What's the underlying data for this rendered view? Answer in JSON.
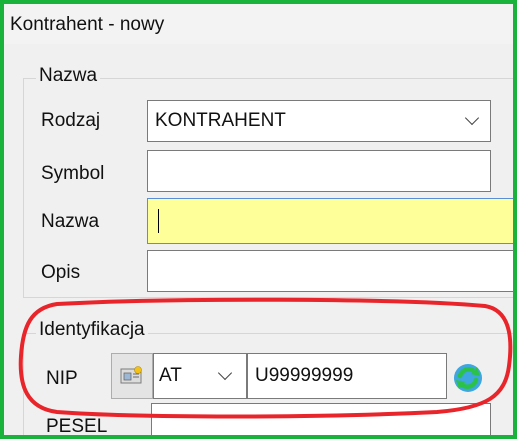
{
  "window": {
    "title": "Kontrahent - nowy",
    "border_color": "#19b23a"
  },
  "nazwa_group": {
    "legend": "Nazwa",
    "rodzaj": {
      "label": "Rodzaj",
      "value": "KONTRAHENT"
    },
    "symbol": {
      "label": "Symbol",
      "value": ""
    },
    "nazwa": {
      "label": "Nazwa",
      "value": "",
      "highlight": "#ffff99"
    },
    "opis": {
      "label": "Opis",
      "value": ""
    }
  },
  "identyfikacja_group": {
    "legend": "Identyfikacja",
    "nip": {
      "label": "NIP",
      "country": "AT",
      "value": "U99999999"
    },
    "pesel": {
      "label": "PESEL",
      "value": ""
    }
  },
  "icons": [
    "card-icon",
    "refresh-icon",
    "chevron-down-icon"
  ],
  "annotation": {
    "shape": "ellipse",
    "color": "#e8252b"
  }
}
